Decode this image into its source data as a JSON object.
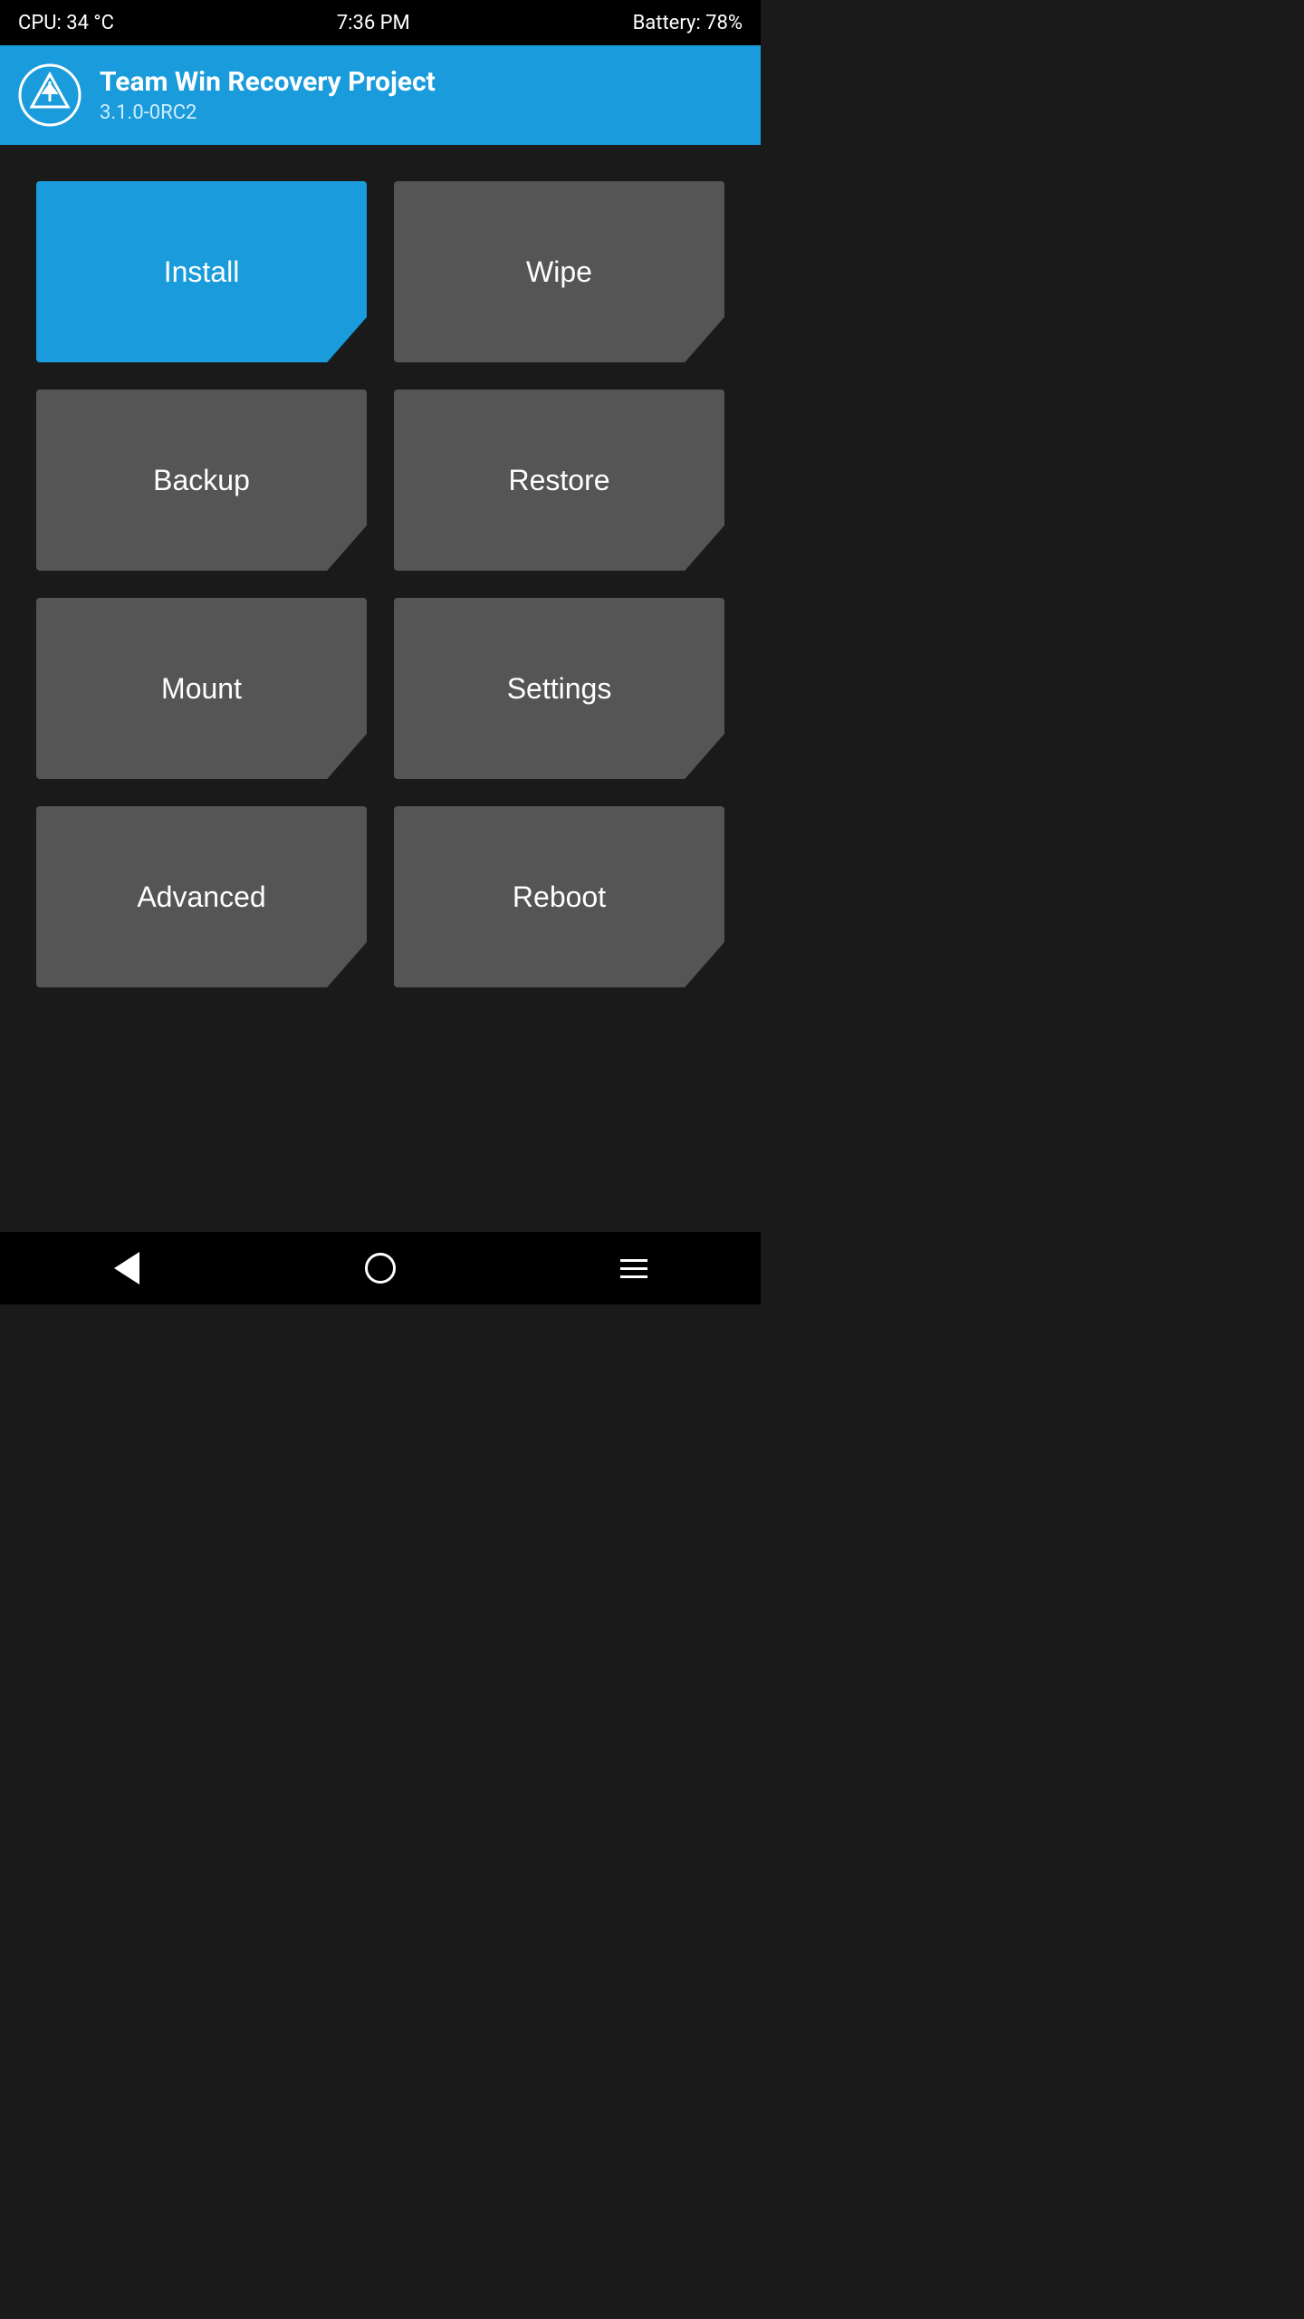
{
  "statusBar": {
    "cpu": "CPU: 34 °C",
    "time": "7:36 PM",
    "battery": "Battery: 78%"
  },
  "header": {
    "appTitle": "Team Win Recovery Project",
    "appVersion": "3.1.0-0RC2",
    "logoAlt": "TWRP Logo"
  },
  "buttons": {
    "install": "Install",
    "wipe": "Wipe",
    "backup": "Backup",
    "restore": "Restore",
    "mount": "Mount",
    "settings": "Settings",
    "advanced": "Advanced",
    "reboot": "Reboot"
  },
  "navBar": {
    "backIcon": "back-icon",
    "homeIcon": "home-icon",
    "menuIcon": "menu-icon"
  }
}
